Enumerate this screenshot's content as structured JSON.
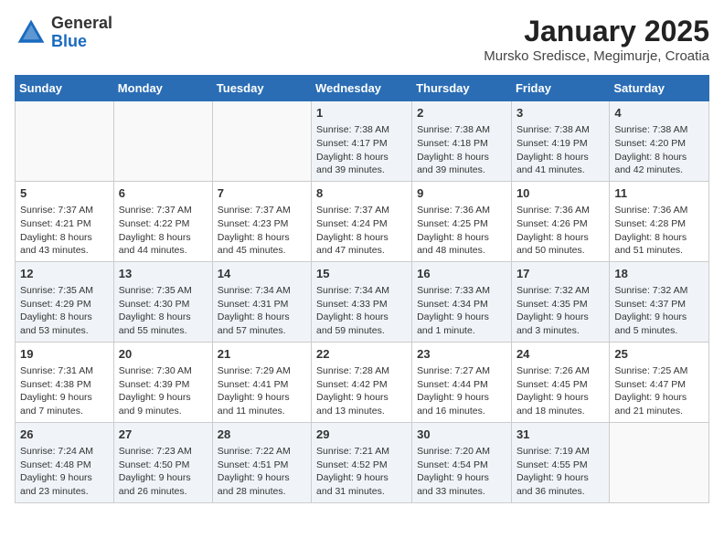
{
  "header": {
    "logo_line1": "General",
    "logo_line2": "Blue",
    "month": "January 2025",
    "location": "Mursko Sredisce, Megimurje, Croatia"
  },
  "weekdays": [
    "Sunday",
    "Monday",
    "Tuesday",
    "Wednesday",
    "Thursday",
    "Friday",
    "Saturday"
  ],
  "weeks": [
    [
      null,
      null,
      null,
      {
        "day": 1,
        "sunrise": "7:38 AM",
        "sunset": "4:17 PM",
        "daylight": "8 hours and 39 minutes."
      },
      {
        "day": 2,
        "sunrise": "7:38 AM",
        "sunset": "4:18 PM",
        "daylight": "8 hours and 39 minutes."
      },
      {
        "day": 3,
        "sunrise": "7:38 AM",
        "sunset": "4:19 PM",
        "daylight": "8 hours and 41 minutes."
      },
      {
        "day": 4,
        "sunrise": "7:38 AM",
        "sunset": "4:20 PM",
        "daylight": "8 hours and 42 minutes."
      }
    ],
    [
      {
        "day": 5,
        "sunrise": "7:37 AM",
        "sunset": "4:21 PM",
        "daylight": "8 hours and 43 minutes."
      },
      {
        "day": 6,
        "sunrise": "7:37 AM",
        "sunset": "4:22 PM",
        "daylight": "8 hours and 44 minutes."
      },
      {
        "day": 7,
        "sunrise": "7:37 AM",
        "sunset": "4:23 PM",
        "daylight": "8 hours and 45 minutes."
      },
      {
        "day": 8,
        "sunrise": "7:37 AM",
        "sunset": "4:24 PM",
        "daylight": "8 hours and 47 minutes."
      },
      {
        "day": 9,
        "sunrise": "7:36 AM",
        "sunset": "4:25 PM",
        "daylight": "8 hours and 48 minutes."
      },
      {
        "day": 10,
        "sunrise": "7:36 AM",
        "sunset": "4:26 PM",
        "daylight": "8 hours and 50 minutes."
      },
      {
        "day": 11,
        "sunrise": "7:36 AM",
        "sunset": "4:28 PM",
        "daylight": "8 hours and 51 minutes."
      }
    ],
    [
      {
        "day": 12,
        "sunrise": "7:35 AM",
        "sunset": "4:29 PM",
        "daylight": "8 hours and 53 minutes."
      },
      {
        "day": 13,
        "sunrise": "7:35 AM",
        "sunset": "4:30 PM",
        "daylight": "8 hours and 55 minutes."
      },
      {
        "day": 14,
        "sunrise": "7:34 AM",
        "sunset": "4:31 PM",
        "daylight": "8 hours and 57 minutes."
      },
      {
        "day": 15,
        "sunrise": "7:34 AM",
        "sunset": "4:33 PM",
        "daylight": "8 hours and 59 minutes."
      },
      {
        "day": 16,
        "sunrise": "7:33 AM",
        "sunset": "4:34 PM",
        "daylight": "9 hours and 1 minute."
      },
      {
        "day": 17,
        "sunrise": "7:32 AM",
        "sunset": "4:35 PM",
        "daylight": "9 hours and 3 minutes."
      },
      {
        "day": 18,
        "sunrise": "7:32 AM",
        "sunset": "4:37 PM",
        "daylight": "9 hours and 5 minutes."
      }
    ],
    [
      {
        "day": 19,
        "sunrise": "7:31 AM",
        "sunset": "4:38 PM",
        "daylight": "9 hours and 7 minutes."
      },
      {
        "day": 20,
        "sunrise": "7:30 AM",
        "sunset": "4:39 PM",
        "daylight": "9 hours and 9 minutes."
      },
      {
        "day": 21,
        "sunrise": "7:29 AM",
        "sunset": "4:41 PM",
        "daylight": "9 hours and 11 minutes."
      },
      {
        "day": 22,
        "sunrise": "7:28 AM",
        "sunset": "4:42 PM",
        "daylight": "9 hours and 13 minutes."
      },
      {
        "day": 23,
        "sunrise": "7:27 AM",
        "sunset": "4:44 PM",
        "daylight": "9 hours and 16 minutes."
      },
      {
        "day": 24,
        "sunrise": "7:26 AM",
        "sunset": "4:45 PM",
        "daylight": "9 hours and 18 minutes."
      },
      {
        "day": 25,
        "sunrise": "7:25 AM",
        "sunset": "4:47 PM",
        "daylight": "9 hours and 21 minutes."
      }
    ],
    [
      {
        "day": 26,
        "sunrise": "7:24 AM",
        "sunset": "4:48 PM",
        "daylight": "9 hours and 23 minutes."
      },
      {
        "day": 27,
        "sunrise": "7:23 AM",
        "sunset": "4:50 PM",
        "daylight": "9 hours and 26 minutes."
      },
      {
        "day": 28,
        "sunrise": "7:22 AM",
        "sunset": "4:51 PM",
        "daylight": "9 hours and 28 minutes."
      },
      {
        "day": 29,
        "sunrise": "7:21 AM",
        "sunset": "4:52 PM",
        "daylight": "9 hours and 31 minutes."
      },
      {
        "day": 30,
        "sunrise": "7:20 AM",
        "sunset": "4:54 PM",
        "daylight": "9 hours and 33 minutes."
      },
      {
        "day": 31,
        "sunrise": "7:19 AM",
        "sunset": "4:55 PM",
        "daylight": "9 hours and 36 minutes."
      },
      null
    ]
  ],
  "labels": {
    "sunrise": "Sunrise:",
    "sunset": "Sunset:",
    "daylight": "Daylight:"
  }
}
